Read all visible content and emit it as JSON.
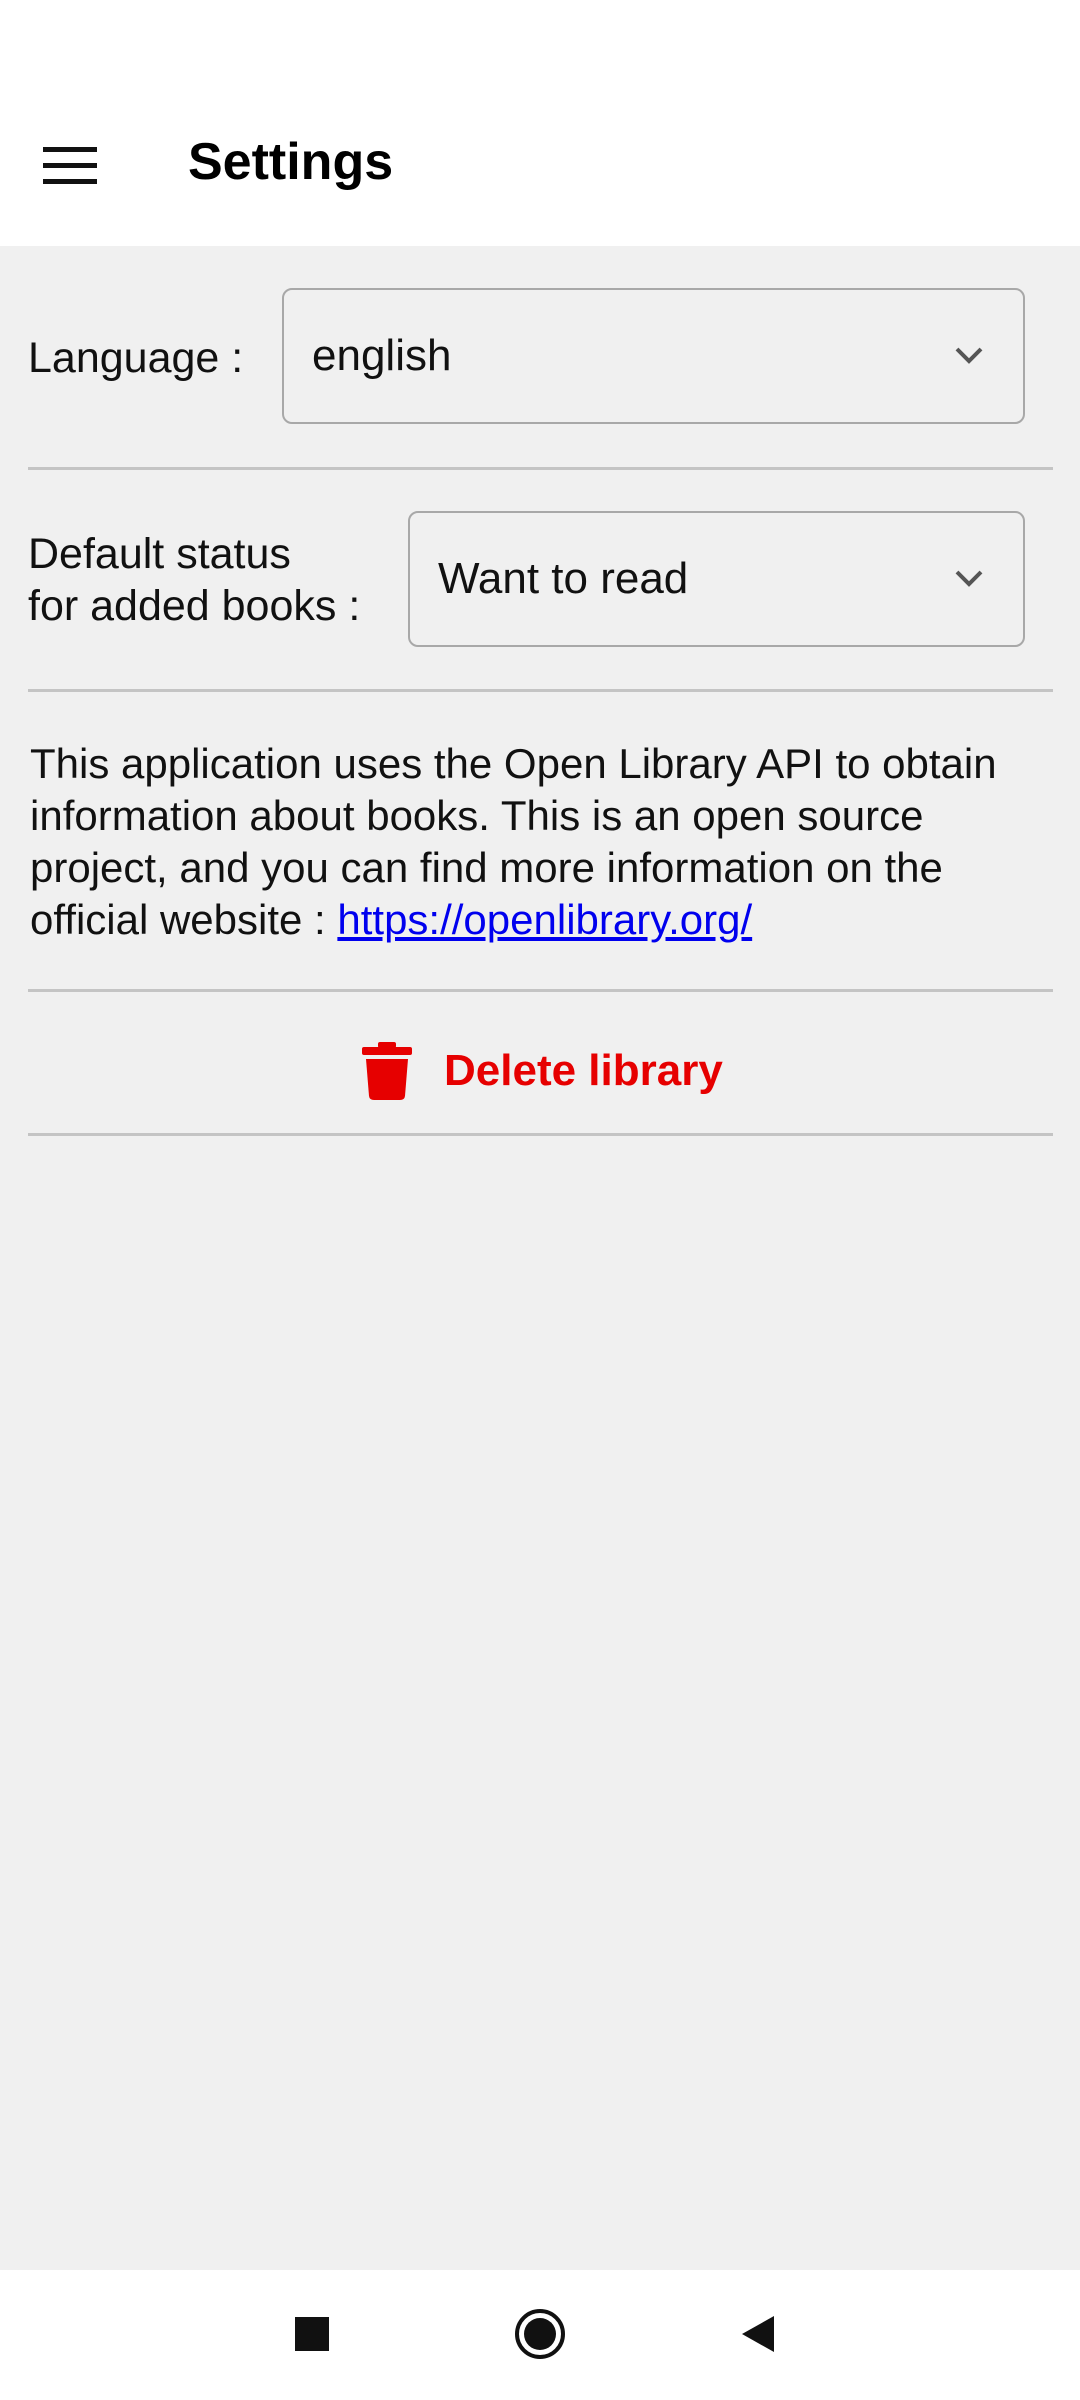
{
  "header": {
    "title": "Settings",
    "menu_icon": "hamburger-menu-icon"
  },
  "settings": {
    "language": {
      "label": "Language :",
      "value": "english"
    },
    "default_status": {
      "label_line1": "Default status",
      "label_line2": "for added books :",
      "value": "Want to read"
    }
  },
  "info": {
    "text": "This application uses the Open Library API to obtain information about books. This is an open source project, and you can find more information on the official website : ",
    "link": "https://openlibrary.org/"
  },
  "delete": {
    "label": "Delete library",
    "icon": "trash-icon"
  },
  "colors": {
    "danger": "#e60000",
    "link": "#0000ee",
    "background": "#f0f0f0"
  },
  "nav": {
    "recents_icon": "square-recents-icon",
    "home_icon": "circle-home-icon",
    "back_icon": "triangle-back-icon"
  }
}
